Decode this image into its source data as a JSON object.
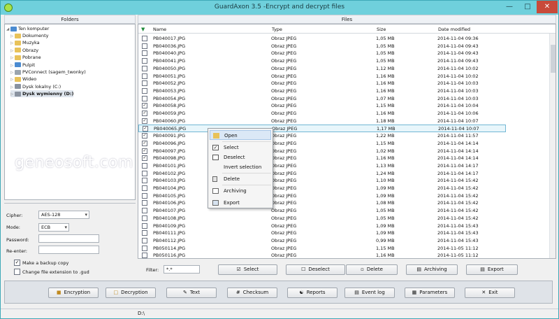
{
  "window": {
    "title": "GuardAxon 3.5 -Encrypt and decrypt files",
    "min": "—",
    "max": "□",
    "close": "✕"
  },
  "folders_panel": {
    "title": "Folders",
    "root": "Ten komputer",
    "items": [
      "Dokumenty",
      "Muzyka",
      "Obrazy",
      "Pobrane",
      "Pulpit",
      "PVConnect (sagem_twonky)",
      "Wideo",
      "Dysk lokalny (C:)",
      "Dysk wymienny (D:)"
    ],
    "selected": "Dysk wymienny (D:)"
  },
  "settings": {
    "cipher_label": "Cipher:",
    "cipher_value": "AES-128",
    "mode_label": "Mode:",
    "mode_value": "ECB",
    "password_label": "Password:",
    "reenter_label": "Re-enter:",
    "backup_label": "Make a backup copy",
    "backup_checked": true,
    "ext_label": "Change file extension to .gud",
    "ext_checked": false
  },
  "files_panel": {
    "title": "Files",
    "columns": {
      "name": "Name",
      "type": "Type",
      "size": "Size",
      "date": "Date modified"
    },
    "rows": [
      {
        "name": "PB040017.JPG",
        "type": "Obraz JPEG",
        "size": "1,05 MB",
        "date": "2014-11-04 09:36",
        "checked": false
      },
      {
        "name": "PB040036.JPG",
        "type": "Obraz JPEG",
        "size": "1,05 MB",
        "date": "2014-11-04 09:43",
        "checked": false
      },
      {
        "name": "PB040040.JPG",
        "type": "Obraz JPEG",
        "size": "1,05 MB",
        "date": "2014-11-04 09:43",
        "checked": false
      },
      {
        "name": "PB040041.JPG",
        "type": "Obraz JPEG",
        "size": "1,05 MB",
        "date": "2014-11-04 09:43",
        "checked": false
      },
      {
        "name": "PB040050.JPG",
        "type": "Obraz JPEG",
        "size": "1,12 MB",
        "date": "2014-11-04 10:02",
        "checked": false
      },
      {
        "name": "PB040051.JPG",
        "type": "Obraz JPEG",
        "size": "1,16 MB",
        "date": "2014-11-04 10:02",
        "checked": false
      },
      {
        "name": "PB040052.JPG",
        "type": "Obraz JPEG",
        "size": "1,16 MB",
        "date": "2014-11-04 10:03",
        "checked": false
      },
      {
        "name": "PB040053.JPG",
        "type": "Obraz JPEG",
        "size": "1,16 MB",
        "date": "2014-11-04 10:03",
        "checked": false
      },
      {
        "name": "PB040054.JPG",
        "type": "Obraz JPEG",
        "size": "1,07 MB",
        "date": "2014-11-04 10:03",
        "checked": false
      },
      {
        "name": "PB040058.JPG",
        "type": "Obraz JPEG",
        "size": "1,15 MB",
        "date": "2014-11-04 10:04",
        "checked": true
      },
      {
        "name": "PB040059.JPG",
        "type": "Obraz JPEG",
        "size": "1,16 MB",
        "date": "2014-11-04 10:06",
        "checked": true
      },
      {
        "name": "PB040060.JPG",
        "type": "Obraz JPEG",
        "size": "1,18 MB",
        "date": "2014-11-04 10:07",
        "checked": true
      },
      {
        "name": "PB040065.JPG",
        "type": "Obraz JPEG",
        "size": "1,17 MB",
        "date": "2014-11-04 10:07",
        "checked": true
      },
      {
        "name": "PB040091.JPG",
        "type": "Obraz JPEG",
        "size": "1,22 MB",
        "date": "2014-11-04 11:57",
        "checked": true
      },
      {
        "name": "PB040096.JPG",
        "type": "Obraz JPEG",
        "size": "1,15 MB",
        "date": "2014-11-04 14:14",
        "checked": true
      },
      {
        "name": "PB040097.JPG",
        "type": "Obraz JPEG",
        "size": "1,02 MB",
        "date": "2014-11-04 14:14",
        "checked": true
      },
      {
        "name": "PB040098.JPG",
        "type": "Obraz JPEG",
        "size": "1,16 MB",
        "date": "2014-11-04 14:14",
        "checked": true
      },
      {
        "name": "PB040101.JPG",
        "type": "Obraz JPEG",
        "size": "1,13 MB",
        "date": "2014-11-04 14:17",
        "checked": false
      },
      {
        "name": "PB040102.JPG",
        "type": "Obraz JPEG",
        "size": "1,24 MB",
        "date": "2014-11-04 14:17",
        "checked": false
      },
      {
        "name": "PB040103.JPG",
        "type": "Obraz JPEG",
        "size": "1,10 MB",
        "date": "2014-11-04 15:42",
        "checked": false
      },
      {
        "name": "PB040104.JPG",
        "type": "Obraz JPEG",
        "size": "1,09 MB",
        "date": "2014-11-04 15:42",
        "checked": false
      },
      {
        "name": "PB040105.JPG",
        "type": "Obraz JPEG",
        "size": "1,09 MB",
        "date": "2014-11-04 15:42",
        "checked": false
      },
      {
        "name": "PB040106.JPG",
        "type": "Obraz JPEG",
        "size": "1,08 MB",
        "date": "2014-11-04 15:42",
        "checked": false
      },
      {
        "name": "PB040107.JPG",
        "type": "Obraz JPEG",
        "size": "1,05 MB",
        "date": "2014-11-04 15:42",
        "checked": false
      },
      {
        "name": "PB040108.JPG",
        "type": "Obraz JPEG",
        "size": "1,05 MB",
        "date": "2014-11-04 15:42",
        "checked": false
      },
      {
        "name": "PB040109.JPG",
        "type": "Obraz JPEG",
        "size": "1,09 MB",
        "date": "2014-11-04 15:43",
        "checked": false
      },
      {
        "name": "PB040111.JPG",
        "type": "Obraz JPEG",
        "size": "1,09 MB",
        "date": "2014-11-04 15:43",
        "checked": false
      },
      {
        "name": "PB040112.JPG",
        "type": "Obraz JPEG",
        "size": "0,99 MB",
        "date": "2014-11-04 15:43",
        "checked": false
      },
      {
        "name": "PB050114.JPG",
        "type": "Obraz JPEG",
        "size": "1,15 MB",
        "date": "2014-11-05 11:12",
        "checked": false
      },
      {
        "name": "PB050116.JPG",
        "type": "Obraz JPEG",
        "size": "1,16 MB",
        "date": "2014-11-05 11:12",
        "checked": false
      }
    ],
    "highlighted_row": "PB040065.JPG"
  },
  "context_menu": {
    "items": [
      "Open",
      "Select",
      "Deselect",
      "Invert selection",
      "Delete",
      "Archiving",
      "Export"
    ]
  },
  "filter": {
    "label": "Filter:",
    "value": "*.*"
  },
  "file_actions": {
    "select": "Select",
    "deselect": "Deselect",
    "delete": "Delete",
    "archiving": "Archiving",
    "export": "Export"
  },
  "toolbar": {
    "encryption": "Encryption",
    "decryption": "Decryption",
    "text": "Text",
    "checksum": "Checksum",
    "reports": "Reports",
    "event_log": "Event log",
    "parameters": "Parameters",
    "exit": "Exit"
  },
  "status": {
    "path": "D:\\"
  },
  "watermark": "geneosoft.com",
  "colors": {
    "titlebar": "#6fd0dc",
    "close": "#c84a3a",
    "highlight_border": "#72b7d4",
    "folder_icon": "#e8c25a"
  }
}
